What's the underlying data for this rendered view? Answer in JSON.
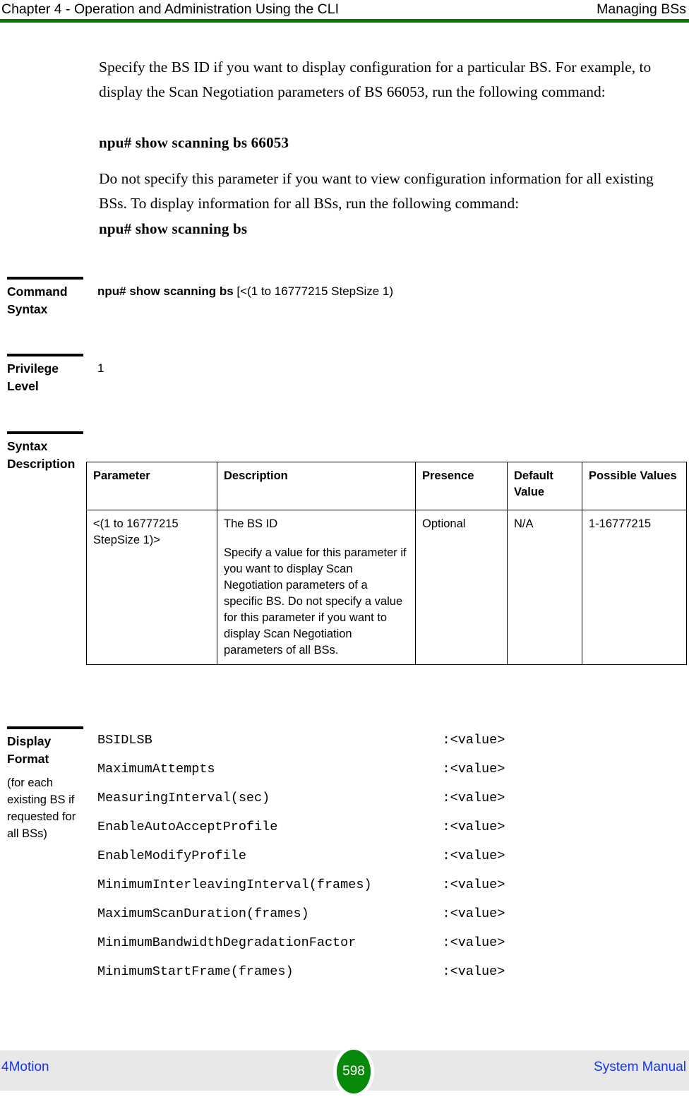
{
  "header": {
    "left": "Chapter 4 - Operation and Administration Using the CLI",
    "right": "Managing BSs",
    "rule_color": "#007a00"
  },
  "body": {
    "paragraph_1": "Specify the BS ID if you want to display configuration for a particular BS. For example, to display the Scan Negotiation parameters of BS 66053, run the following command:",
    "command_1": "npu# show scanning bs 66053",
    "paragraph_2": "Do not specify this parameter if you want to view configuration information for all existing BSs. To display information for all BSs, run the following command:",
    "command_2": "npu# show scanning bs"
  },
  "fields": {
    "command_syntax": {
      "label": "Command Syntax",
      "value_bold": "npu# show scanning bs",
      "value_rest": " [<(1 to 16777215 StepSize 1)"
    },
    "privilege_level": {
      "label": "Privilege Level",
      "value": "1"
    },
    "syntax_description": {
      "label": "Syntax Description"
    },
    "display_format": {
      "label": "Display Format",
      "sublabel": "(for each existing BS if requested for all BSs)"
    }
  },
  "param_table": {
    "columns": [
      "Parameter",
      "Description",
      "Presence",
      "Default Value",
      "Possible Values"
    ],
    "rows": [
      {
        "parameter": "<(1 to 16777215 StepSize 1)>",
        "description_1": "The BS ID",
        "description_2": "Specify a value for this parameter if you want to display Scan Negotiation parameters of a specific BS. Do not specify a value for this parameter if you want to display Scan Negotiation parameters of all BSs.",
        "presence": "Optional",
        "default_value": "N/A",
        "possible_values": "1-16777215"
      }
    ]
  },
  "display_format_lines": [
    {
      "name": "BSIDLSB",
      "value": ":<value>"
    },
    {
      "name": "MaximumAttempts",
      "value": ":<value>"
    },
    {
      "name": "MeasuringInterval(sec)",
      "value": ":<value>"
    },
    {
      "name": "EnableAutoAcceptProfile",
      "value": ":<value>"
    },
    {
      "name": "EnableModifyProfile",
      "value": ":<value>"
    },
    {
      "name": "MinimumInterleavingInterval(frames)",
      "value": ":<value>"
    },
    {
      "name": "MaximumScanDuration(frames)",
      "value": ":<value>"
    },
    {
      "name": "MinimumBandwidthDegradationFactor",
      "value": ":<value>"
    },
    {
      "name": "MinimumStartFrame(frames)",
      "value": ":<value>"
    }
  ],
  "display_format_value_column": 44,
  "footer": {
    "left": "4Motion",
    "page_number": "598",
    "right": "System Manual",
    "link_color": "#1535f0",
    "badge_color": "#078a0c",
    "band_color": "#e8e8e8"
  }
}
